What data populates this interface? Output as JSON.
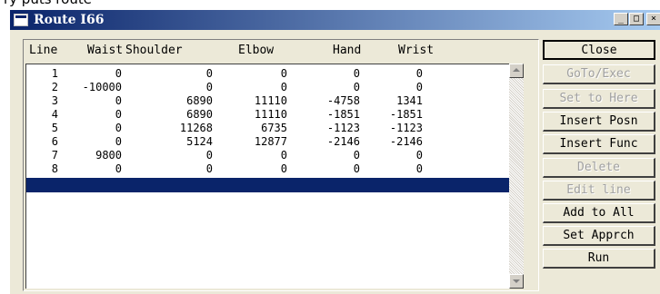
{
  "top_fragment_text": "ry puts route",
  "window": {
    "title": "Route I66",
    "minimize_glyph": "_",
    "maximize_glyph": "□",
    "close_glyph": "×"
  },
  "columns": [
    "Line",
    "Waist",
    "Shoulder",
    "Elbow",
    "Hand",
    "Wrist"
  ],
  "rows": [
    {
      "line": "1",
      "waist": "0",
      "shoulder": "0",
      "elbow": "0",
      "hand": "0",
      "wrist": "0"
    },
    {
      "line": "2",
      "waist": "-10000",
      "shoulder": "0",
      "elbow": "0",
      "hand": "0",
      "wrist": "0"
    },
    {
      "line": "3",
      "waist": "0",
      "shoulder": "6890",
      "elbow": "11110",
      "hand": "-4758",
      "wrist": "1341"
    },
    {
      "line": "4",
      "waist": "0",
      "shoulder": "6890",
      "elbow": "11110",
      "hand": "-1851",
      "wrist": "-1851"
    },
    {
      "line": "5",
      "waist": "0",
      "shoulder": "11268",
      "elbow": "6735",
      "hand": "-1123",
      "wrist": "-1123"
    },
    {
      "line": "6",
      "waist": "0",
      "shoulder": "5124",
      "elbow": "12877",
      "hand": "-2146",
      "wrist": "-2146"
    },
    {
      "line": "7",
      "waist": "9800",
      "shoulder": "0",
      "elbow": "0",
      "hand": "0",
      "wrist": "0"
    },
    {
      "line": "8",
      "waist": "0",
      "shoulder": "0",
      "elbow": "0",
      "hand": "0",
      "wrist": "0"
    }
  ],
  "selected_row_index": 8,
  "buttons": [
    {
      "label": "Close",
      "enabled": true
    },
    {
      "label": "GoTo/Exec",
      "enabled": false
    },
    {
      "label": "Set to Here",
      "enabled": false
    },
    {
      "label": "Insert Posn",
      "enabled": true
    },
    {
      "label": "Insert Func",
      "enabled": true
    },
    {
      "label": "Delete",
      "enabled": false
    },
    {
      "label": "Edit line",
      "enabled": false
    },
    {
      "label": "Add to All",
      "enabled": true
    },
    {
      "label": "Set Apprch",
      "enabled": true
    },
    {
      "label": "Run",
      "enabled": true
    }
  ],
  "colors": {
    "title_gradient_start": "#0a246a",
    "title_gradient_end": "#a6caf0",
    "selection": "#0a246a",
    "disabled_text": "#a0a0a0"
  }
}
